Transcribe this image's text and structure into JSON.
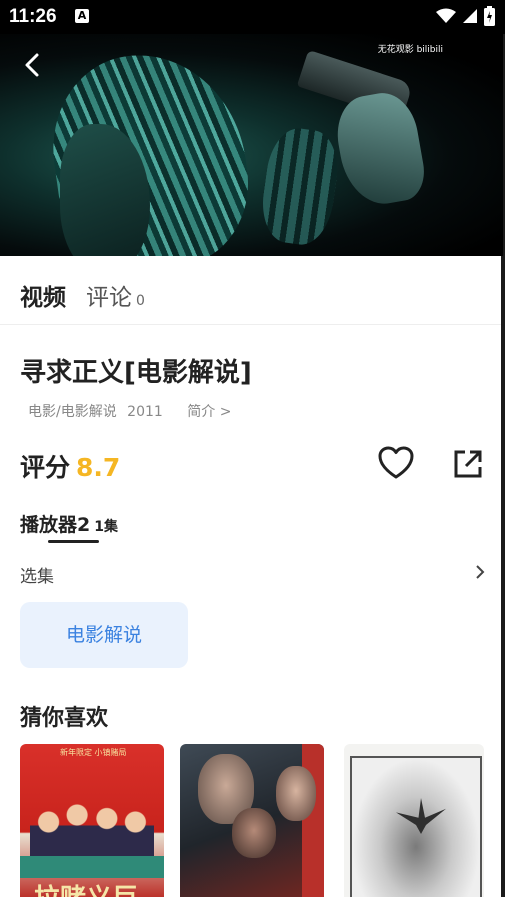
{
  "status_bar": {
    "time": "11:26",
    "notification_icon": "A"
  },
  "video": {
    "watermark": "无花观影 bilibili"
  },
  "tabs": {
    "video_label": "视频",
    "comment_label": "评论",
    "comment_count": "0"
  },
  "detail": {
    "title": "寻求正义[电影解说]",
    "category": "电影/电影解说",
    "year": "2011",
    "intro_label": "简介 >",
    "rating_label": "评分",
    "rating_value": "8.7"
  },
  "player": {
    "name": "播放器2",
    "episodes": "1集"
  },
  "episode_select": {
    "label": "选集"
  },
  "episodes": [
    {
      "label": "电影解说"
    }
  ],
  "recommend": {
    "title": "猜你喜欢",
    "posters": [
      {
        "caption": "新年限定 小镇赌局",
        "big_text": "拉赌义巨"
      },
      {
        "caption": ""
      },
      {
        "caption": ""
      }
    ]
  },
  "colors": {
    "accent_rating": "#f5b623",
    "chip_bg": "#eaf2fd",
    "chip_text": "#3b82e0"
  }
}
